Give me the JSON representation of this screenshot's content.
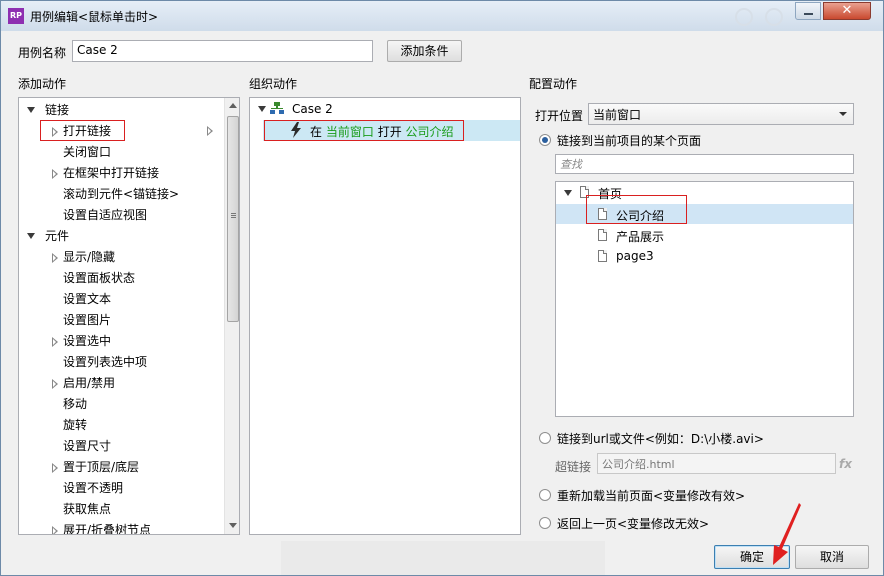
{
  "window": {
    "title": "用例编辑<鼠标单击时>",
    "app_icon": "RP",
    "close_glyph": "✕"
  },
  "case_name": {
    "label": "用例名称",
    "value": "Case 2",
    "add_condition_button": "添加条件"
  },
  "add_actions": {
    "header": "添加动作",
    "items": [
      {
        "label": "链接",
        "level": 0,
        "expander": "expanded"
      },
      {
        "label": "打开链接",
        "level": 1,
        "expander": "collapsed"
      },
      {
        "label": "关闭窗口",
        "level": 1,
        "expander": "none"
      },
      {
        "label": "在框架中打开链接",
        "level": 1,
        "expander": "collapsed"
      },
      {
        "label": "滚动到元件<锚链接>",
        "level": 1,
        "expander": "none"
      },
      {
        "label": "设置自适应视图",
        "level": 1,
        "expander": "none"
      },
      {
        "label": "元件",
        "level": 0,
        "expander": "expanded"
      },
      {
        "label": "显示/隐藏",
        "level": 1,
        "expander": "collapsed"
      },
      {
        "label": "设置面板状态",
        "level": 1,
        "expander": "none"
      },
      {
        "label": "设置文本",
        "level": 1,
        "expander": "none"
      },
      {
        "label": "设置图片",
        "level": 1,
        "expander": "none"
      },
      {
        "label": "设置选中",
        "level": 1,
        "expander": "collapsed"
      },
      {
        "label": "设置列表选中项",
        "level": 1,
        "expander": "none"
      },
      {
        "label": "启用/禁用",
        "level": 1,
        "expander": "collapsed"
      },
      {
        "label": "移动",
        "level": 1,
        "expander": "none"
      },
      {
        "label": "旋转",
        "level": 1,
        "expander": "none"
      },
      {
        "label": "设置尺寸",
        "level": 1,
        "expander": "none"
      },
      {
        "label": "置于顶层/底层",
        "level": 1,
        "expander": "collapsed"
      },
      {
        "label": "设置不透明",
        "level": 1,
        "expander": "none"
      },
      {
        "label": "获取焦点",
        "level": 1,
        "expander": "none"
      },
      {
        "label": "展开/折叠树节点",
        "level": 1,
        "expander": "collapsed"
      }
    ]
  },
  "organize_actions": {
    "header": "组织动作",
    "case_label": "Case 2",
    "action": {
      "prefix": "在",
      "target": "当前窗口",
      "verb": "打开",
      "page": "公司介绍"
    }
  },
  "configure_actions": {
    "header": "配置动作",
    "open_location_label": "打开位置",
    "open_location_value": "当前窗口",
    "option_link_page": "链接到当前项目的某个页面",
    "search_placeholder": "查找",
    "pages": [
      {
        "label": "首页",
        "level": 0
      },
      {
        "label": "公司介绍",
        "level": 1,
        "selected": true
      },
      {
        "label": "产品展示",
        "level": 1
      },
      {
        "label": "page3",
        "level": 1
      }
    ],
    "option_link_url": "链接到url或文件<例如：D:\\小楼.avi>",
    "hyperlink_label": "超链接",
    "hyperlink_value": "公司介绍.html",
    "fx_label": "fx",
    "option_reload": "重新加载当前页面<变量修改有效>",
    "option_back": "返回上一页<变量修改无效>",
    "selected_option": "link_page"
  },
  "footer": {
    "ok": "确定",
    "cancel": "取消"
  },
  "colors": {
    "highlight": "#cce8f4",
    "annotation_red": "#d92020",
    "green_text": "#1a9c1a",
    "selection_blue": "#d0e5f5"
  }
}
